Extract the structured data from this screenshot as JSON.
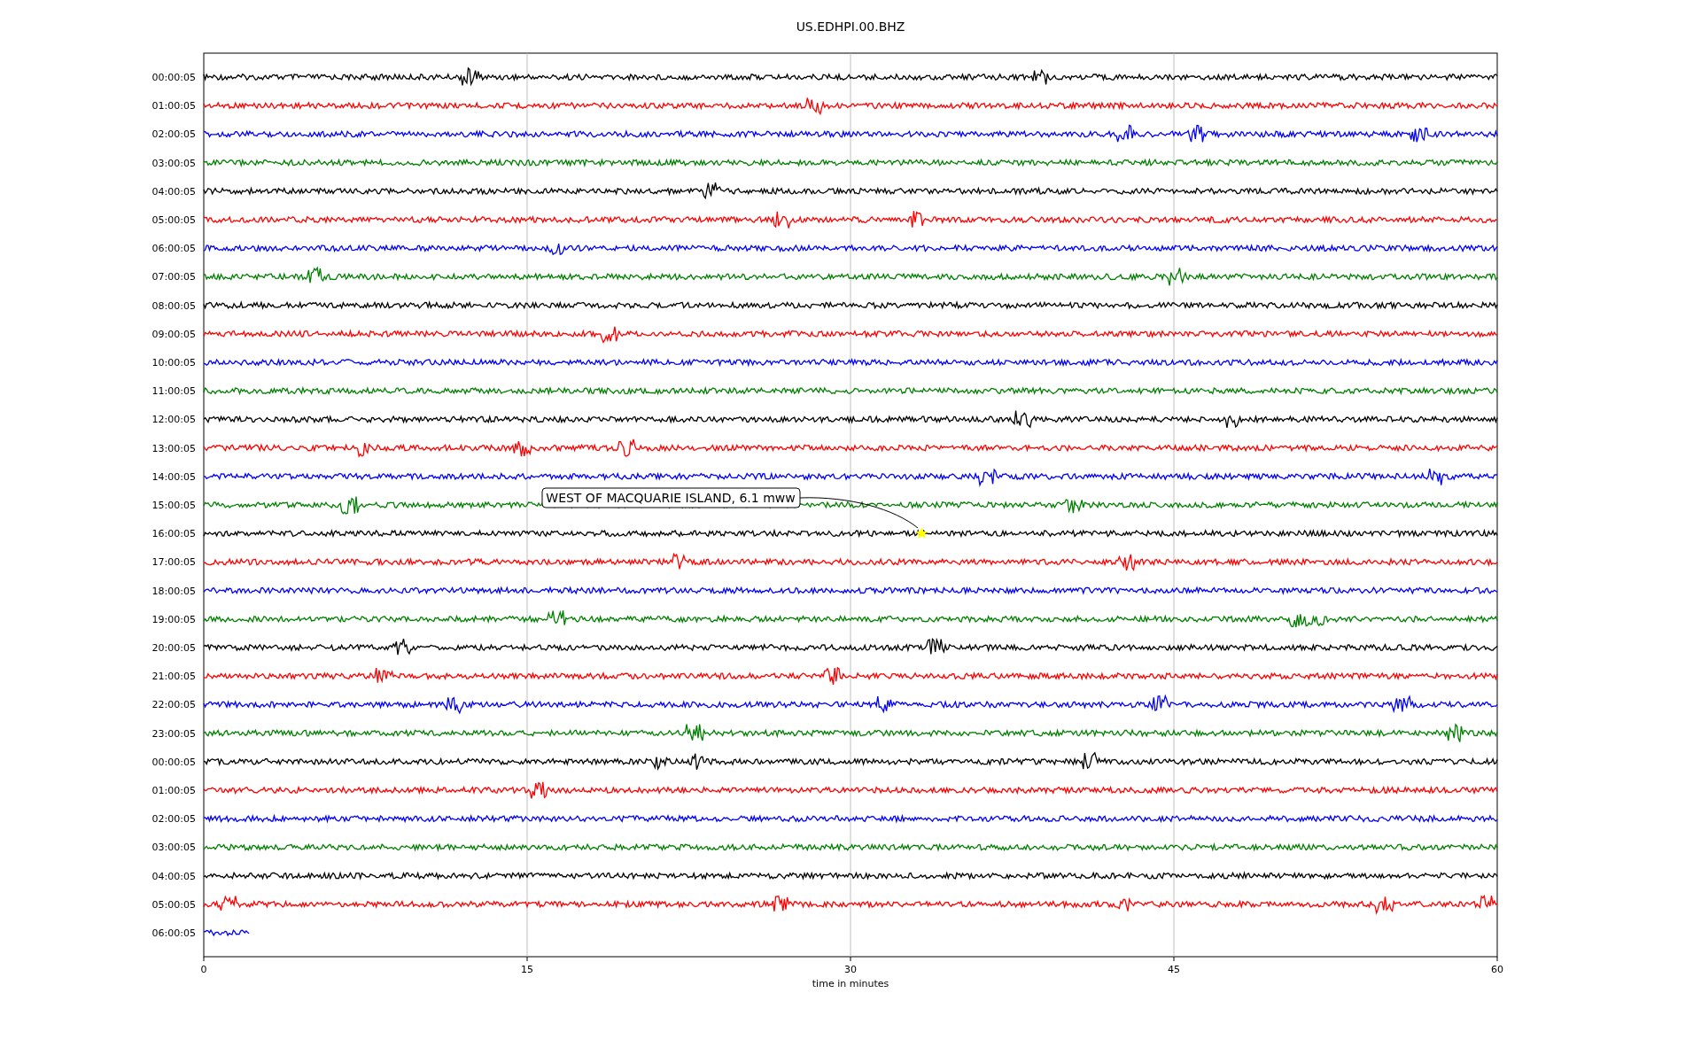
{
  "title": "US.EDHPI.00.BHZ",
  "xaxis": {
    "label": "time in minutes",
    "ticks": [
      "0",
      "15",
      "30",
      "45",
      "60"
    ]
  },
  "traces": [
    {
      "label": "00:00:05",
      "color": "#000000",
      "level": 1
    },
    {
      "label": "01:00:05",
      "color": "#ff0000",
      "level": 1
    },
    {
      "label": "02:00:05",
      "color": "#0000ff",
      "level": 1
    },
    {
      "label": "03:00:05",
      "color": "#008000",
      "level": 1
    },
    {
      "label": "04:00:05",
      "color": "#000000",
      "level": 1
    },
    {
      "label": "05:00:05",
      "color": "#ff0000",
      "level": 1
    },
    {
      "label": "06:00:05",
      "color": "#0000ff",
      "level": 1
    },
    {
      "label": "07:00:05",
      "color": "#008000",
      "level": 1
    },
    {
      "label": "08:00:05",
      "color": "#000000",
      "level": 1
    },
    {
      "label": "09:00:05",
      "color": "#ff0000",
      "level": 1
    },
    {
      "label": "10:00:05",
      "color": "#0000ff",
      "level": 1
    },
    {
      "label": "11:00:05",
      "color": "#008000",
      "level": 1
    },
    {
      "label": "12:00:05",
      "color": "#000000",
      "level": 1
    },
    {
      "label": "13:00:05",
      "color": "#ff0000",
      "level": 1
    },
    {
      "label": "14:00:05",
      "color": "#0000ff",
      "level": 1
    },
    {
      "label": "15:00:05",
      "color": "#008000",
      "level": 1
    },
    {
      "label": "16:00:05",
      "color": "#000000",
      "level": 1
    },
    {
      "label": "17:00:05",
      "color": "#ff0000",
      "level": 1
    },
    {
      "label": "18:00:05",
      "color": "#0000ff",
      "level": 1
    },
    {
      "label": "19:00:05",
      "color": "#008000",
      "level": 1
    },
    {
      "label": "20:00:05",
      "color": "#000000",
      "level": 1
    },
    {
      "label": "21:00:05",
      "color": "#ff0000",
      "level": 1
    },
    {
      "label": "22:00:05",
      "color": "#0000ff",
      "level": 1
    },
    {
      "label": "23:00:05",
      "color": "#008000",
      "level": 1
    },
    {
      "label": "00:00:05",
      "color": "#000000",
      "level": 1
    },
    {
      "label": "01:00:05",
      "color": "#ff0000",
      "level": 1
    },
    {
      "label": "02:00:05",
      "color": "#0000ff",
      "level": 1
    },
    {
      "label": "03:00:05",
      "color": "#008000",
      "level": 1
    },
    {
      "label": "04:00:05",
      "color": "#000000",
      "level": 1
    },
    {
      "label": "05:00:05",
      "color": "#ff0000",
      "level": 1
    },
    {
      "label": "06:00:05",
      "color": "#0000ff",
      "level": 0.035
    }
  ],
  "event": {
    "label": "WEST OF MACQUARIE ISLAND, 6.1 mww"
  }
}
